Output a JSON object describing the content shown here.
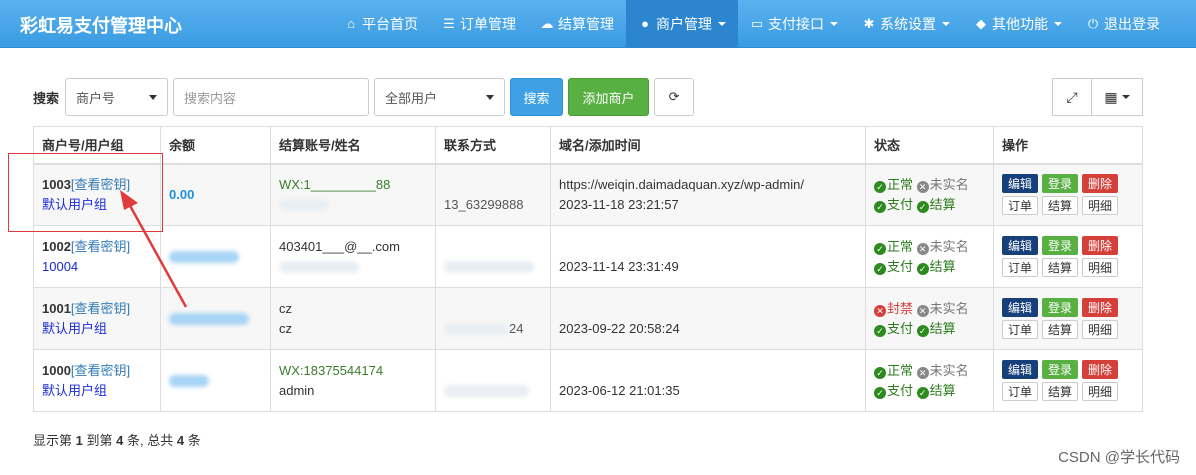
{
  "brand": "彩虹易支付管理中心",
  "nav": [
    {
      "icon": "home-icon",
      "glyph": "⌂",
      "label": "平台首页",
      "dropdown": false,
      "active": false
    },
    {
      "icon": "list-icon",
      "glyph": "☰",
      "label": "订单管理",
      "dropdown": false,
      "active": false
    },
    {
      "icon": "cloud-icon",
      "glyph": "☁",
      "label": "结算管理",
      "dropdown": false,
      "active": false
    },
    {
      "icon": "user-icon",
      "glyph": "●",
      "label": "商户管理",
      "dropdown": true,
      "active": true
    },
    {
      "icon": "card-icon",
      "glyph": "▭",
      "label": "支付接口",
      "dropdown": true,
      "active": false
    },
    {
      "icon": "gear-icon",
      "glyph": "✱",
      "label": "系统设置",
      "dropdown": true,
      "active": false
    },
    {
      "icon": "cube-icon",
      "glyph": "◆",
      "label": "其他功能",
      "dropdown": true,
      "active": false
    },
    {
      "icon": "power-icon",
      "glyph": "⏻",
      "label": "退出登录",
      "dropdown": false,
      "active": false
    }
  ],
  "toolbar": {
    "search_label": "搜索",
    "field_select": "商户号",
    "search_placeholder": "搜索内容",
    "user_filter": "全部用户",
    "search_button": "搜索",
    "add_button": "添加商户"
  },
  "table": {
    "headers": [
      "商户号/用户组",
      "余额",
      "结算账号/姓名",
      "联系方式",
      "域名/添加时间",
      "状态",
      "操作"
    ],
    "rows": [
      {
        "uid": "1003",
        "key_link": "[查看密钥]",
        "group": "默认用户组",
        "balance": "0.00",
        "account": "WX:1_________88",
        "contact": "13_63299888",
        "domain": "https://weiqin.daimadaquan.xyz/wp-admin/",
        "time": "2023-11-18 23:21:57",
        "status": [
          "正常",
          "未实名",
          "支付",
          "结算"
        ],
        "status_ok": true
      },
      {
        "uid": "1002",
        "key_link": "[查看密钥]",
        "group": "10004",
        "balance": "",
        "account": "403401___@__.com",
        "contact": "",
        "domain": "",
        "time": "2023-11-14 23:31:49",
        "status": [
          "正常",
          "未实名",
          "支付",
          "结算"
        ],
        "status_ok": true
      },
      {
        "uid": "1001",
        "key_link": "[查看密钥]",
        "group": "默认用户组",
        "balance": "",
        "account": "cz",
        "account2": "cz",
        "contact": "24",
        "domain": "",
        "time": "2023-09-22 20:58:24",
        "status": [
          "封禁",
          "未实名",
          "支付",
          "结算"
        ],
        "status_ok": false
      },
      {
        "uid": "1000",
        "key_link": "[查看密钥]",
        "group": "默认用户组",
        "balance": "",
        "account": "WX:18375544174",
        "account2": "admin",
        "contact": "",
        "domain": "",
        "time": "2023-06-12 21:01:35",
        "status": [
          "正常",
          "未实名",
          "支付",
          "结算"
        ],
        "status_ok": true
      }
    ],
    "ops": [
      "编辑",
      "登录",
      "删除",
      "订单",
      "结算",
      "明细"
    ]
  },
  "footer": {
    "prefix": "显示第",
    "from": "1",
    "mid": "到第",
    "to": "4",
    "suffix": "条, 总共",
    "total": "4",
    "end": "条"
  },
  "watermark": "CSDN @学长代码",
  "colors": {
    "nav_bg": "#3a9be2",
    "accent": "#3fa0e6",
    "green": "#58b043",
    "danger": "#d43f3a",
    "edit": "#173f7a"
  }
}
